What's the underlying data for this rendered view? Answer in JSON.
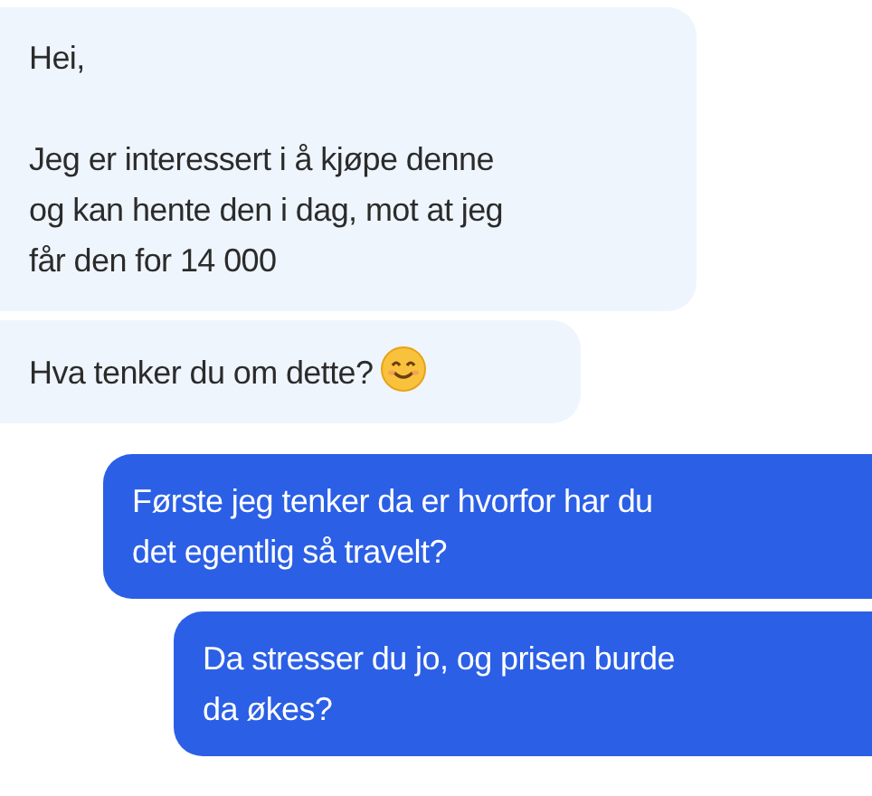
{
  "messages": [
    {
      "kind": "received",
      "paragraphs": [
        "Hei,",
        "Jeg er interessert i å kjøpe denne\nog kan hente den i dag, mot at jeg\nfår den for 14 000"
      ],
      "emoji": false
    },
    {
      "kind": "received",
      "paragraphs": [
        "Hva tenker du om dette?"
      ],
      "emoji": true
    },
    {
      "kind": "sent",
      "paragraphs": [
        "Første jeg tenker da er hvorfor har du\ndet egentlig så travelt?"
      ],
      "emoji": false
    },
    {
      "kind": "sent",
      "paragraphs": [
        "Da stresser du jo, og prisen burde\nda økes?"
      ],
      "emoji": false
    }
  ]
}
